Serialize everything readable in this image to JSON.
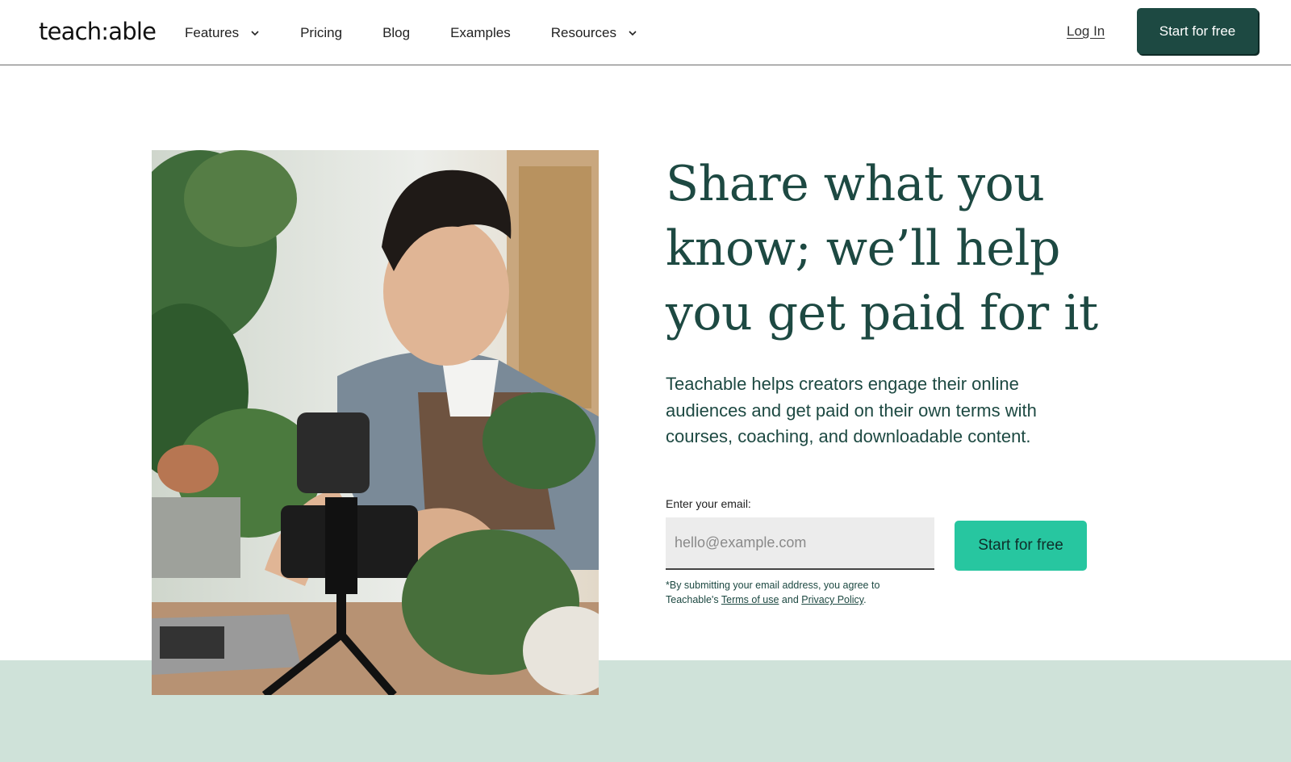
{
  "header": {
    "logo": "teach:able",
    "nav": [
      {
        "label": "Features",
        "dropdown": true
      },
      {
        "label": "Pricing",
        "dropdown": false
      },
      {
        "label": "Blog",
        "dropdown": false
      },
      {
        "label": "Examples",
        "dropdown": false
      },
      {
        "label": "Resources",
        "dropdown": true
      }
    ],
    "login": "Log In",
    "cta": "Start for free"
  },
  "hero": {
    "headline": "Share what you know; we’ll help you get paid for it",
    "subtext": "Teachable helps creators engage their online audiences and get paid on their own terms with courses, coaching, and downloadable content.",
    "email_label": "Enter your email:",
    "email_placeholder": "hello@example.com",
    "cta": "Start for free",
    "disclaimer_prefix": "*By submitting your email address, you agree to Teachable's ",
    "terms_link": "Terms of use",
    "disclaimer_and": " and ",
    "privacy_link": "Privacy Policy",
    "disclaimer_suffix": "."
  },
  "colors": {
    "brand_dark": "#1d4942",
    "brand_accent": "#27c6a0",
    "band": "#cfe2d9"
  }
}
